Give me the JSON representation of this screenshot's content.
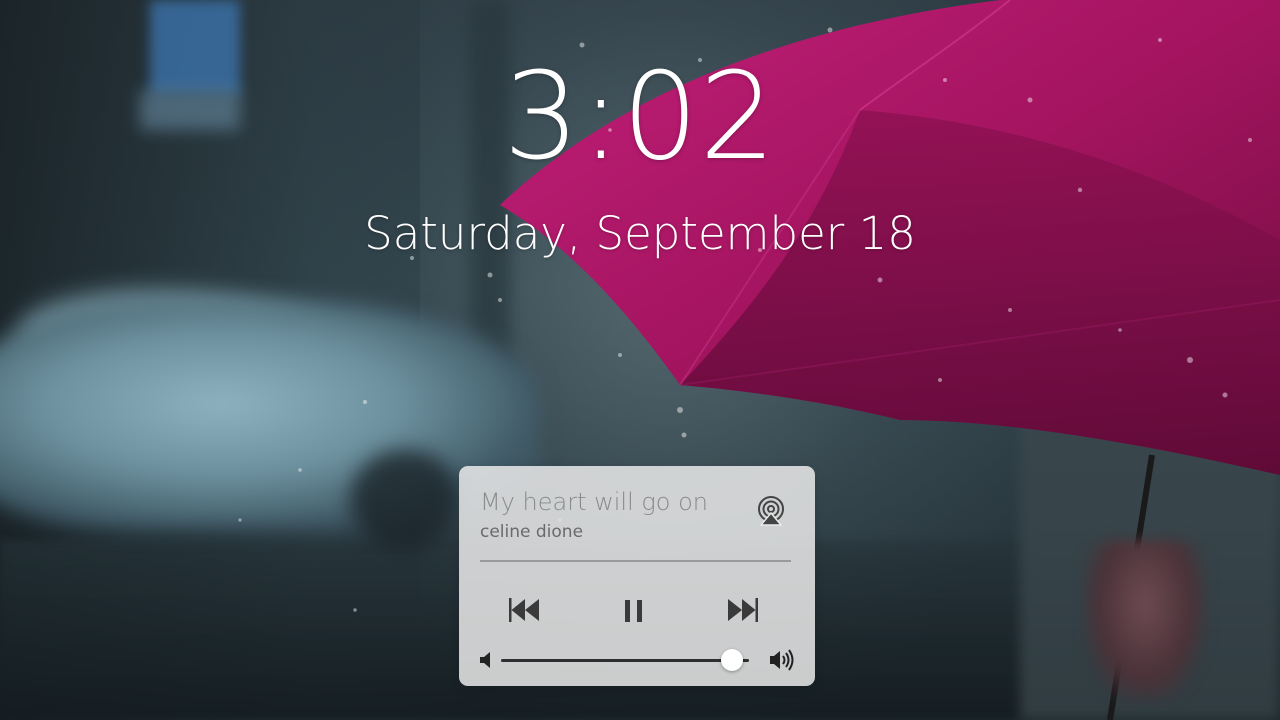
{
  "lockscreen": {
    "time": "3:02",
    "date": "Saturday, September 18"
  },
  "media": {
    "title": "My heart will go on",
    "artist": "celine dione",
    "playback_state": "playing",
    "volume_fraction": 0.93
  },
  "icons": {
    "airplay": "airplay-icon",
    "previous": "previous-track-icon",
    "pause": "pause-icon",
    "next": "next-track-icon",
    "volume_low": "volume-low-icon",
    "volume_high": "volume-high-icon"
  },
  "colors": {
    "umbrella": "#b01a6e",
    "widget_background": "#e9e9e9",
    "text_primary": "#ffffff",
    "control_icons": "#3a3a3a"
  }
}
